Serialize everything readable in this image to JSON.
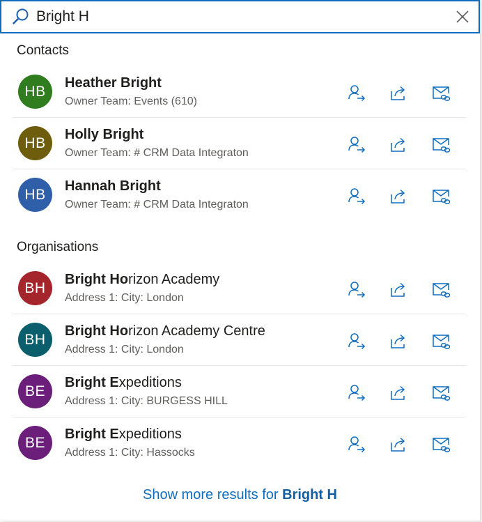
{
  "search": {
    "value": "Bright H",
    "placeholder": ""
  },
  "colors": {
    "accent": "#0f6cbd",
    "border": "#0f6cbd"
  },
  "sections": {
    "contacts": {
      "title": "Contacts",
      "items": [
        {
          "initials": "HB",
          "avatar_color": "#2f7d1e",
          "name_bold": "Heather Bright",
          "name_rest": "",
          "subtitle": "Owner Team: Events (610)"
        },
        {
          "initials": "HB",
          "avatar_color": "#6d5d0c",
          "name_bold": "Holly Bright",
          "name_rest": "",
          "subtitle": "Owner Team: # CRM Data Integraton"
        },
        {
          "initials": "HB",
          "avatar_color": "#2e5fa8",
          "name_bold": "Hannah Bright",
          "name_rest": "",
          "subtitle": "Owner Team: # CRM Data Integraton"
        }
      ]
    },
    "organisations": {
      "title": "Organisations",
      "items": [
        {
          "initials": "BH",
          "avatar_color": "#a4262c",
          "name_bold": "Bright Ho",
          "name_rest": "rizon Academy",
          "subtitle": "Address 1: City: London"
        },
        {
          "initials": "BH",
          "avatar_color": "#0b5e6b",
          "name_bold": "Bright Ho",
          "name_rest": "rizon Academy Centre",
          "subtitle": "Address 1: City: London"
        },
        {
          "initials": "BE",
          "avatar_color": "#6b1f7b",
          "name_bold": "Bright E",
          "name_rest": "xpeditions",
          "subtitle": "Address 1: City: BURGESS HILL"
        },
        {
          "initials": "BE",
          "avatar_color": "#6b1f7b",
          "name_bold": "Bright E",
          "name_rest": "xpeditions",
          "subtitle": "Address 1: City: Hassocks"
        }
      ]
    }
  },
  "row_actions": [
    "assign-icon",
    "share-icon",
    "email-link-icon"
  ],
  "show_more": {
    "prefix": "Show more results for ",
    "query": "Bright H"
  }
}
